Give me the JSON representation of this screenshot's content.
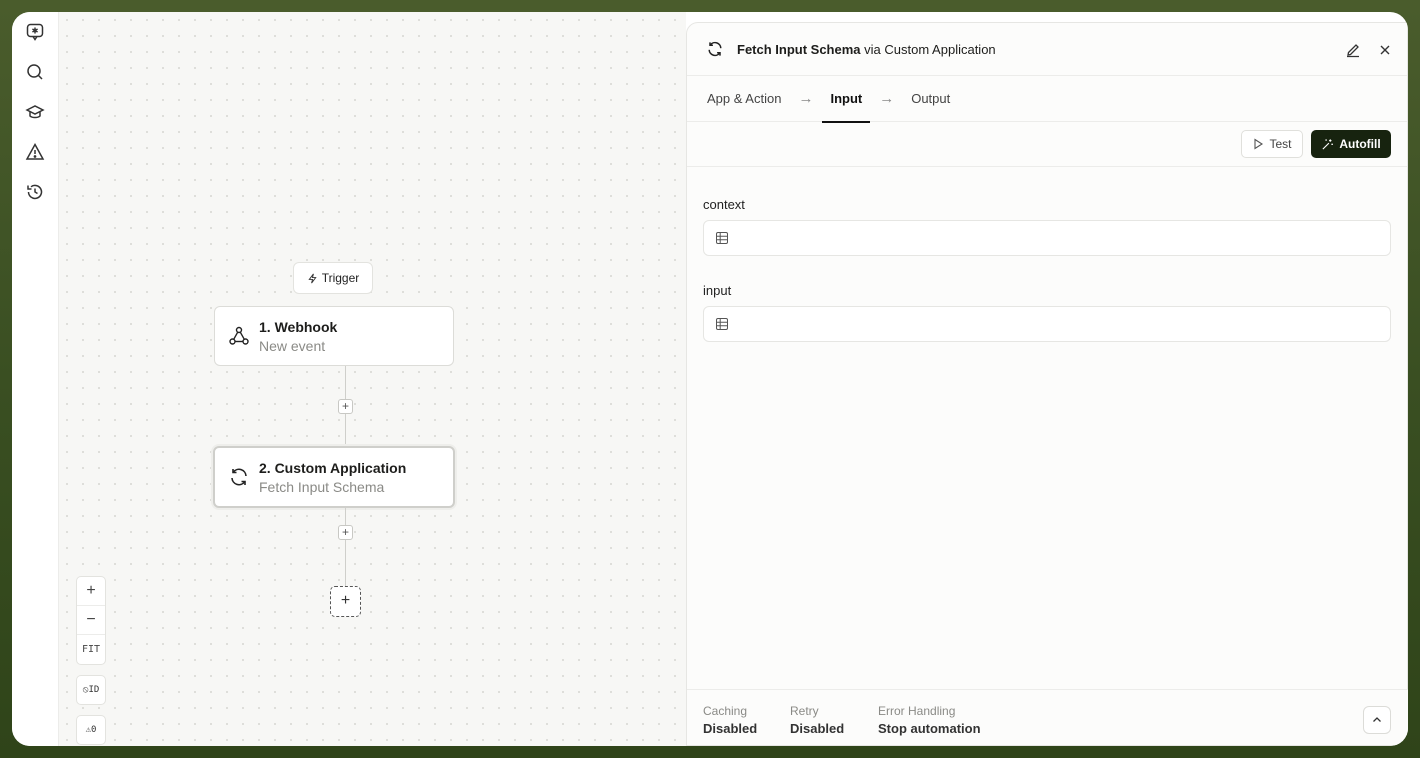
{
  "rail": {
    "items": [
      {
        "icon": "logo-chat-icon"
      },
      {
        "icon": "search-icon"
      },
      {
        "icon": "graduation-cap-icon"
      },
      {
        "icon": "warning-triangle-icon"
      },
      {
        "icon": "history-icon"
      }
    ]
  },
  "canvas": {
    "trigger_label": "Trigger",
    "nodes": [
      {
        "title": "1. Webhook",
        "subtitle": "New event",
        "icon": "webhook-icon"
      },
      {
        "title": "2. Custom Application",
        "subtitle": "Fetch Input Schema",
        "icon": "refresh-icon"
      }
    ],
    "add_step": "+",
    "insert_step": "+",
    "zoom": {
      "in": "+",
      "out": "−",
      "fit": "FIT"
    },
    "id_toggle": "⦸ID",
    "warnings": "⚠0"
  },
  "panel": {
    "title_main": "Fetch Input Schema",
    "title_via": " via ",
    "title_app": "Custom Application",
    "tabs": [
      {
        "label": "App & Action"
      },
      {
        "label": "Input",
        "active": true
      },
      {
        "label": "Output"
      }
    ],
    "tab_arrow": "→",
    "test_label": "Test",
    "autofill_label": "Autofill",
    "fields": [
      {
        "label": "context",
        "value": ""
      },
      {
        "label": "input",
        "value": ""
      }
    ],
    "footer": {
      "caching_label": "Caching",
      "caching_value": "Disabled",
      "retry_label": "Retry",
      "retry_value": "Disabled",
      "error_label": "Error Handling",
      "error_value": "Stop automation"
    }
  },
  "colors": {
    "accent_dark": "#17230f",
    "frame_green": "#3a4f22"
  }
}
